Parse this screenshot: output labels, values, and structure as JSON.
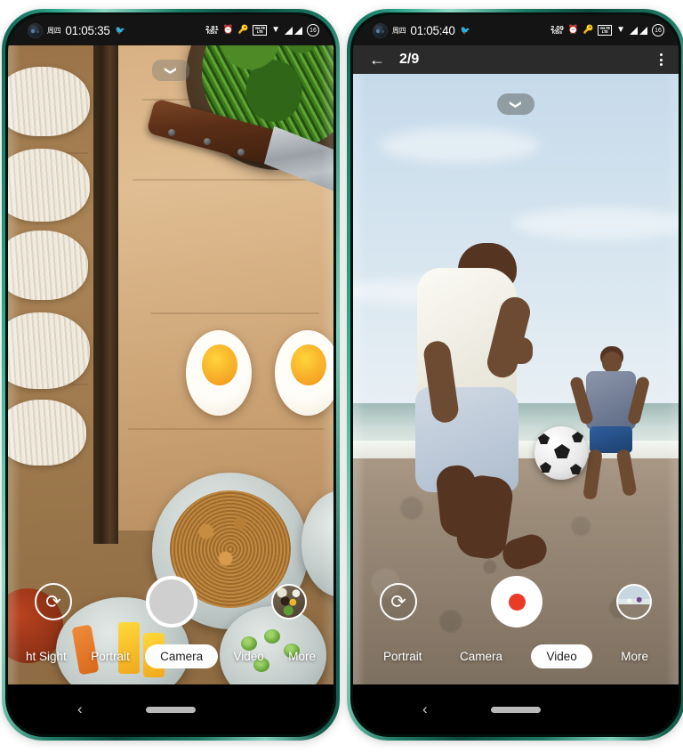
{
  "phones": [
    {
      "id": "left-phone",
      "status_bar": {
        "day": "周四",
        "time": "01:05:35",
        "bird_icon": "bird-icon",
        "net_speed_value": "2.81",
        "net_speed_unit": "KB/s",
        "alarm_icon": "⏰",
        "key_icon": "vpn-key-icon",
        "volte_line1": "VoLTE",
        "volte_line2": "LTE",
        "wifi_icon": "wifi-icon",
        "battery_level": "16"
      },
      "viewfinder": {
        "scene": "food-flatlay-noodles-egg-spinach",
        "chevron_icon": "chevron-down-icon"
      },
      "controls": {
        "flip_camera_icon": "camera-flip-icon",
        "shutter_type": "photo",
        "thumbnail_scene": "spices-bowl-thumbnail"
      },
      "modes": [
        {
          "label": "ht Sight",
          "active": false
        },
        {
          "label": "Portrait",
          "active": false
        },
        {
          "label": "Camera",
          "active": true
        },
        {
          "label": "Video",
          "active": false
        },
        {
          "label": "More",
          "active": false
        }
      ],
      "nav_bar": {
        "back_icon": "‹",
        "home_indicator": "home-pill"
      }
    },
    {
      "id": "right-phone",
      "status_bar": {
        "day": "周四",
        "time": "01:05:40",
        "bird_icon": "bird-icon",
        "net_speed_value": "2.09",
        "net_speed_unit": "KB/s",
        "alarm_icon": "⏰",
        "key_icon": "vpn-key-icon",
        "volte_line1": "VoLTE",
        "volte_line2": "LTE",
        "wifi_icon": "wifi-icon",
        "battery_level": "16"
      },
      "nav_header": {
        "back_icon": "←",
        "title": "2/9",
        "menu_icon": "kebab-menu-icon"
      },
      "viewfinder": {
        "scene": "beach-football-players",
        "chevron_icon": "chevron-down-icon"
      },
      "controls": {
        "flip_camera_icon": "camera-flip-icon",
        "shutter_type": "video",
        "thumbnail_scene": "beach-players-thumbnail"
      },
      "modes": [
        {
          "label": "Portrait",
          "active": false
        },
        {
          "label": "Camera",
          "active": false
        },
        {
          "label": "Video",
          "active": true
        },
        {
          "label": "More",
          "active": false
        }
      ],
      "nav_bar": {
        "back_icon": "‹",
        "home_indicator": "home-pill"
      }
    }
  ],
  "colors": {
    "frame": "#2faa8b",
    "record_dot": "#ea3b26",
    "active_pill": "#ffffff",
    "status_bg": "#141414",
    "nav_header_bg": "#2b2b2b"
  }
}
